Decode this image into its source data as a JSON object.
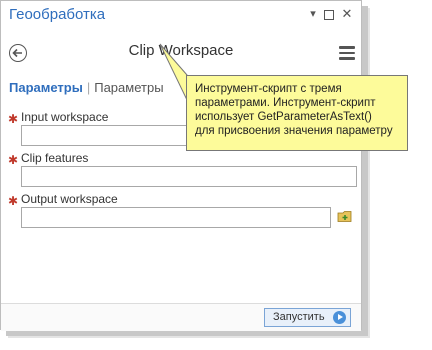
{
  "window": {
    "title": "Геообработка"
  },
  "titlebar_icons": [
    "pin-icon",
    "restore-icon",
    "close-icon"
  ],
  "header": {
    "tool_title": "Clip Workspace"
  },
  "tabs": [
    {
      "label": "Параметры",
      "active": true
    },
    {
      "label": "Параметры",
      "active": false
    }
  ],
  "params": [
    {
      "label": "Input workspace",
      "required": "✱",
      "value": ""
    },
    {
      "label": "Clip features",
      "required": "✱",
      "value": ""
    },
    {
      "label": "Output workspace",
      "required": "✱",
      "value": ""
    }
  ],
  "footer": {
    "run_label": "Запустить"
  },
  "callout": {
    "line1": "Инструмент-скрипт с тремя",
    "line2": "параметрами. Инструмент-скрипт",
    "line3": "использует GetParameterAsText()",
    "line4": "для присвоения значения параметру"
  },
  "colors": {
    "accent": "#2f6ebd",
    "required": "#c0392b",
    "callout_bg": "#fdfb9a"
  }
}
